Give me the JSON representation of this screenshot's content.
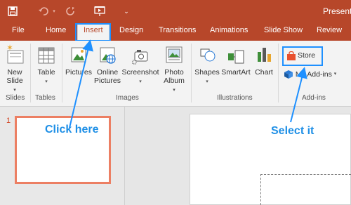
{
  "titlebar": {
    "title": "Present",
    "color": "#b7472a",
    "icons": [
      "save-icon",
      "undo-icon",
      "redo-icon",
      "present-from-start-icon",
      "customize-qat-icon"
    ]
  },
  "tabs": [
    {
      "label": "File",
      "active": false
    },
    {
      "label": "Home",
      "active": false
    },
    {
      "label": "Insert",
      "active": true
    },
    {
      "label": "Design",
      "active": false
    },
    {
      "label": "Transitions",
      "active": false
    },
    {
      "label": "Animations",
      "active": false
    },
    {
      "label": "Slide Show",
      "active": false
    },
    {
      "label": "Review",
      "active": false
    }
  ],
  "ribbon": {
    "slides": {
      "new_slide": "New",
      "new_slide_2": "Slide",
      "group": "Slides"
    },
    "tables": {
      "table": "Table",
      "group": "Tables"
    },
    "images": {
      "pictures": "Pictures",
      "online_pictures": "Online",
      "online_pictures_2": "Pictures",
      "screenshot": "Screenshot",
      "photo_album": "Photo",
      "photo_album_2": "Album",
      "group": "Images"
    },
    "illustrations": {
      "shapes": "Shapes",
      "smartart": "SmartArt",
      "chart": "Chart",
      "group": "Illustrations"
    },
    "addins": {
      "store": "Store",
      "my_addins": "My Add-ins",
      "group": "Add-ins"
    }
  },
  "slide_panel": {
    "slide_number": "1"
  },
  "annotations": {
    "click_here": "Click here",
    "select_it": "Select it",
    "color": "#1e8fe6"
  }
}
